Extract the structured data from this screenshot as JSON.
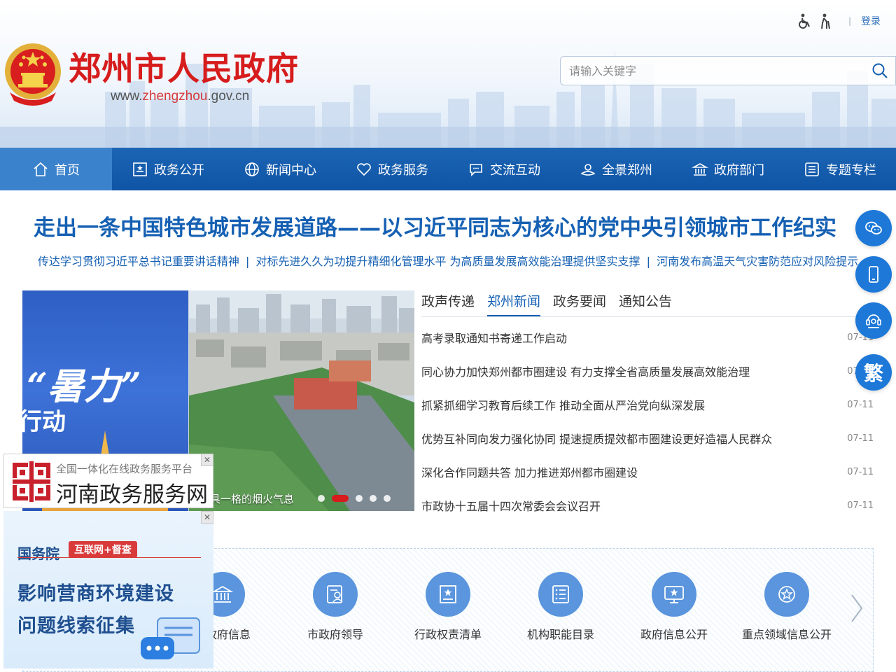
{
  "header": {
    "site_title": "郑州市人民政府",
    "url_prefix": "www.",
    "url_highlight": "zhengzhou",
    "url_suffix": ".gov.cn",
    "login": "登录",
    "search_placeholder": "请输入关键字",
    "tools": [
      "accessibility-icon",
      "elderly-mode-icon"
    ]
  },
  "nav": {
    "items": [
      {
        "label": "首页",
        "icon": "home-icon"
      },
      {
        "label": "政务公开",
        "icon": "document-icon"
      },
      {
        "label": "新闻中心",
        "icon": "globe-icon"
      },
      {
        "label": "政务服务",
        "icon": "heart-icon"
      },
      {
        "label": "交流互动",
        "icon": "chat-icon"
      },
      {
        "label": "全景郑州",
        "icon": "panorama-icon"
      },
      {
        "label": "政府部门",
        "icon": "building-icon"
      },
      {
        "label": "专题专栏",
        "icon": "list-icon"
      }
    ],
    "active_index": 0
  },
  "headline": {
    "title": "走出一条中国特色城市发展道路——以习近平同志为核心的党中央引领城市工作纪实",
    "sub_links": [
      "传达学习贯彻习近平总书记重要讲话精神",
      "对标先进久久为功提升精细化管理水平 为高质量发展高效能治理提供坚实支撑",
      "河南发布高温天气灾害防范应对风险提示"
    ],
    "separator": "|"
  },
  "carousel": {
    "left_big_text": "“暑力”",
    "left_mid_text": "行动",
    "caption": "具一格的烟火气息",
    "dot_count": 5,
    "active_dot": 1
  },
  "news": {
    "tabs": [
      "政声传递",
      "郑州新闻",
      "政务要闻",
      "通知公告"
    ],
    "active_tab": 1,
    "items": [
      {
        "title": "高考录取通知书寄递工作启动",
        "date": "07-11"
      },
      {
        "title": "同心协力加快郑州都市圈建设 有力支撑全省高质量发展高效能治理",
        "date": "07-11"
      },
      {
        "title": "抓紧抓细学习教育后续工作 推动全面从严治党向纵深发展",
        "date": "07-11"
      },
      {
        "title": "优势互补同向发力强化协同 提速提质提效都市圈建设更好造福人民群众",
        "date": "07-11"
      },
      {
        "title": "深化合作同题共答 加力推进郑州都市圈建设",
        "date": "07-11"
      },
      {
        "title": "市政协十五届十四次常委会会议召开",
        "date": "07-11"
      }
    ]
  },
  "services": {
    "items": [
      {
        "label": "市政府信息",
        "icon": "government-building-icon"
      },
      {
        "label": "市政府领导",
        "icon": "leader-profile-icon"
      },
      {
        "label": "行政权责清单",
        "icon": "responsibility-list-icon"
      },
      {
        "label": "机构职能目录",
        "icon": "directory-icon"
      },
      {
        "label": "政府信息公开",
        "icon": "info-disclosure-icon"
      },
      {
        "label": "重点领域信息公开",
        "icon": "key-area-icon"
      }
    ]
  },
  "float_buttons": {
    "items": [
      "wechat-icon",
      "mobile-icon",
      "customer-service-icon"
    ],
    "traditional_label": "繁"
  },
  "ads": {
    "henan": {
      "small": "全国一体化在线政务服务平台",
      "big": "河南政务服务网",
      "close": "✕"
    },
    "state_council": {
      "org": "国务院",
      "tag": "互联网+督查",
      "line1": "影响营商环境建设",
      "line2": "问题线索征集",
      "close": "✕"
    }
  },
  "colors": {
    "brand_blue": "#1560b3",
    "nav_blue": "#1c64b4",
    "title_red": "#d61c1c",
    "float_blue": "#1d78d8"
  }
}
